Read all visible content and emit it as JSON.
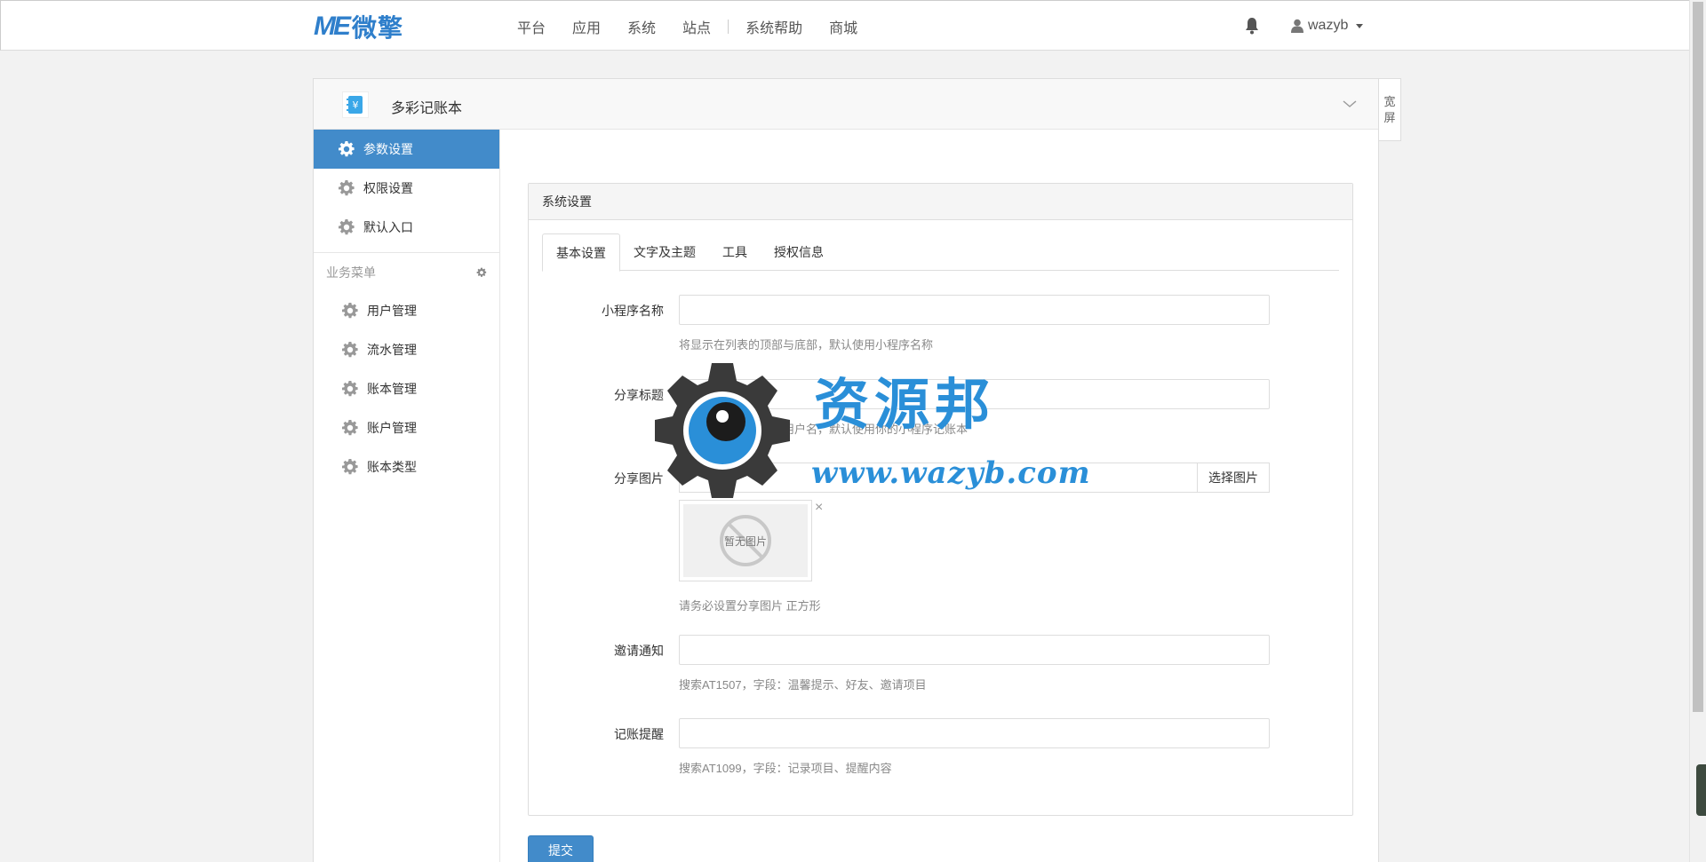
{
  "header": {
    "logo_mark": "ME",
    "logo_text": "微擎",
    "nav": [
      "平台",
      "应用",
      "系统",
      "站点",
      "系统帮助",
      "商城"
    ],
    "username": "wazyb"
  },
  "panel": {
    "app_title": "多彩记账本",
    "app_icon_glyph": "¥",
    "wide_toggle": [
      "宽",
      "屏"
    ]
  },
  "sidebar": {
    "items": [
      {
        "label": "参数设置",
        "active": true
      },
      {
        "label": "权限设置",
        "active": false
      },
      {
        "label": "默认入口",
        "active": false
      }
    ],
    "group_label": "业务菜单",
    "sub_items": [
      {
        "label": "用户管理"
      },
      {
        "label": "流水管理"
      },
      {
        "label": "账本管理"
      },
      {
        "label": "账户管理"
      },
      {
        "label": "账本类型"
      }
    ]
  },
  "card": {
    "title": "系统设置",
    "tabs": [
      {
        "label": "基本设置",
        "active": true
      },
      {
        "label": "文字及主题",
        "active": false
      },
      {
        "label": "工具",
        "active": false
      },
      {
        "label": "授权信息",
        "active": false
      }
    ]
  },
  "form": {
    "app_name": {
      "label": "小程序名称",
      "value": "",
      "help": "将显示在列表的顶部与底部，默认使用小程序名称"
    },
    "share_title": {
      "label": "分享标题",
      "value": "",
      "help": "用用户昵称代替户的用户名，默认使用你的小程序记账本"
    },
    "share_image": {
      "label": "分享图片",
      "value": "",
      "button": "选择图片",
      "empty_label": "暂无图片",
      "help": "请务必设置分享图片 正方形"
    },
    "invite_notice": {
      "label": "邀请通知",
      "value": "",
      "help": "搜索AT1507，字段：温馨提示、好友、邀请项目"
    },
    "record_reminder": {
      "label": "记账提醒",
      "value": "",
      "help": "搜索AT1099，字段：记录项目、提醒内容"
    },
    "submit_label": "提交"
  },
  "watermark": {
    "cn": "资源邦",
    "url": "www.wazyb.com"
  },
  "colors": {
    "primary": "#428bca",
    "logo": "#2f7fcb",
    "watermark": "#2a8fd8"
  }
}
